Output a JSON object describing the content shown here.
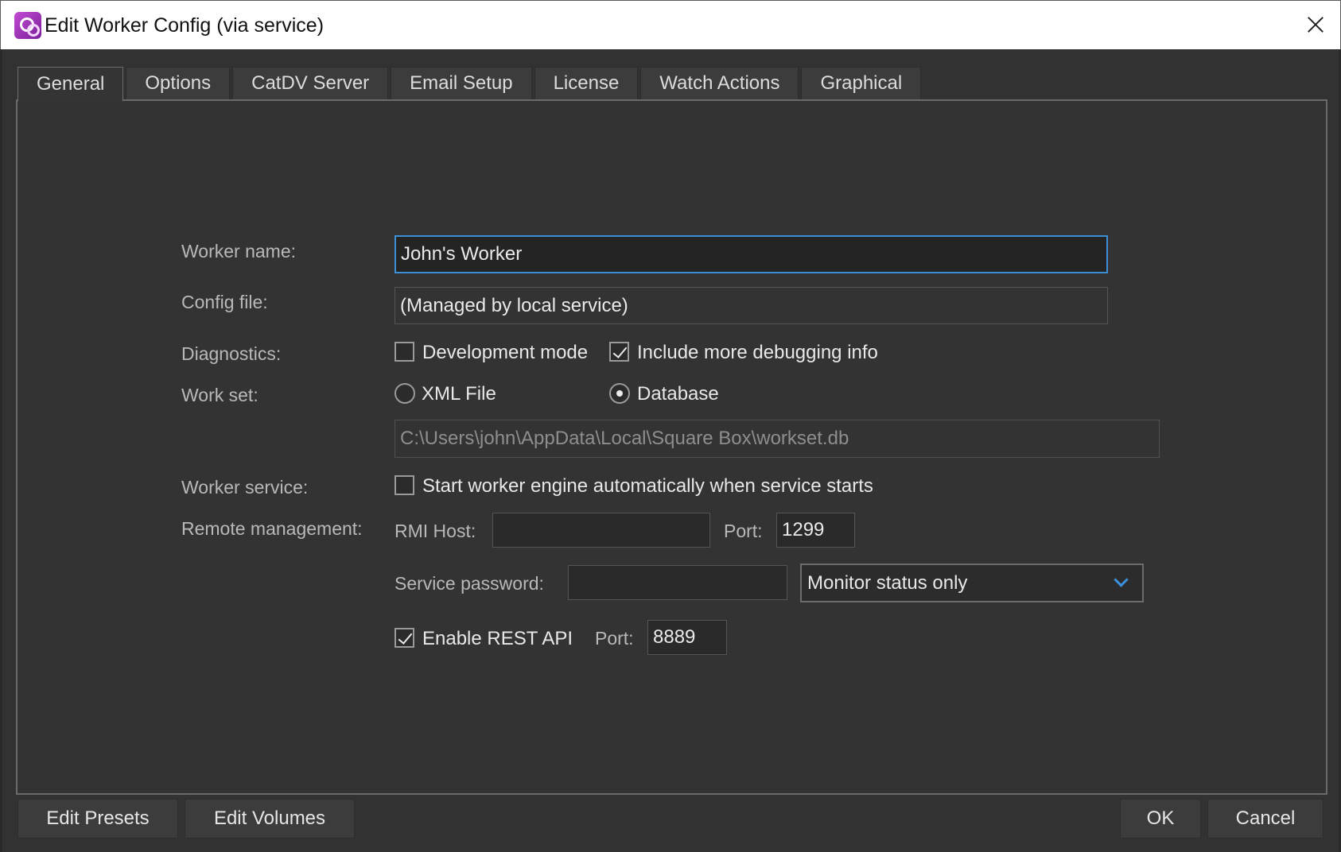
{
  "window": {
    "title": "Edit Worker Config (via service)"
  },
  "tabs": [
    {
      "label": "General"
    },
    {
      "label": "Options"
    },
    {
      "label": "CatDV Server"
    },
    {
      "label": "Email Setup"
    },
    {
      "label": "License"
    },
    {
      "label": "Watch Actions"
    },
    {
      "label": "Graphical"
    }
  ],
  "form": {
    "worker_name_label": "Worker name:",
    "worker_name_value": "John's Worker",
    "config_file_label": "Config file:",
    "config_file_value": "(Managed by local service)",
    "diagnostics_label": "Diagnostics:",
    "development_mode_label": "Development mode",
    "development_mode_checked": false,
    "debug_info_label": "Include more debugging info",
    "debug_info_checked": true,
    "work_set_label": "Work set:",
    "xml_file_label": "XML File",
    "database_label": "Database",
    "work_set_selected": "Database",
    "workset_path": "C:\\Users\\john\\AppData\\Local\\Square Box\\workset.db",
    "worker_service_label": "Worker service:",
    "auto_start_label": "Start worker engine automatically when service starts",
    "auto_start_checked": false,
    "remote_mgmt_label": "Remote management:",
    "rmi_host_label": "RMI Host:",
    "rmi_host_value": "",
    "rmi_port_label": "Port:",
    "rmi_port_value": "1299",
    "service_password_label": "Service password:",
    "service_password_value": "",
    "access_mode_value": "Monitor status only",
    "rest_api_label": "Enable REST API",
    "rest_api_checked": true,
    "rest_port_label": "Port:",
    "rest_port_value": "8889"
  },
  "buttons": {
    "edit_presets": "Edit Presets",
    "edit_volumes": "Edit Volumes",
    "ok": "OK",
    "cancel": "Cancel"
  },
  "colors": {
    "accent": "#3c8ed6",
    "background": "#323232"
  },
  "icons": {
    "app": "catdv-app-icon",
    "close": "close-icon",
    "dropdown": "chevron-down-icon"
  }
}
